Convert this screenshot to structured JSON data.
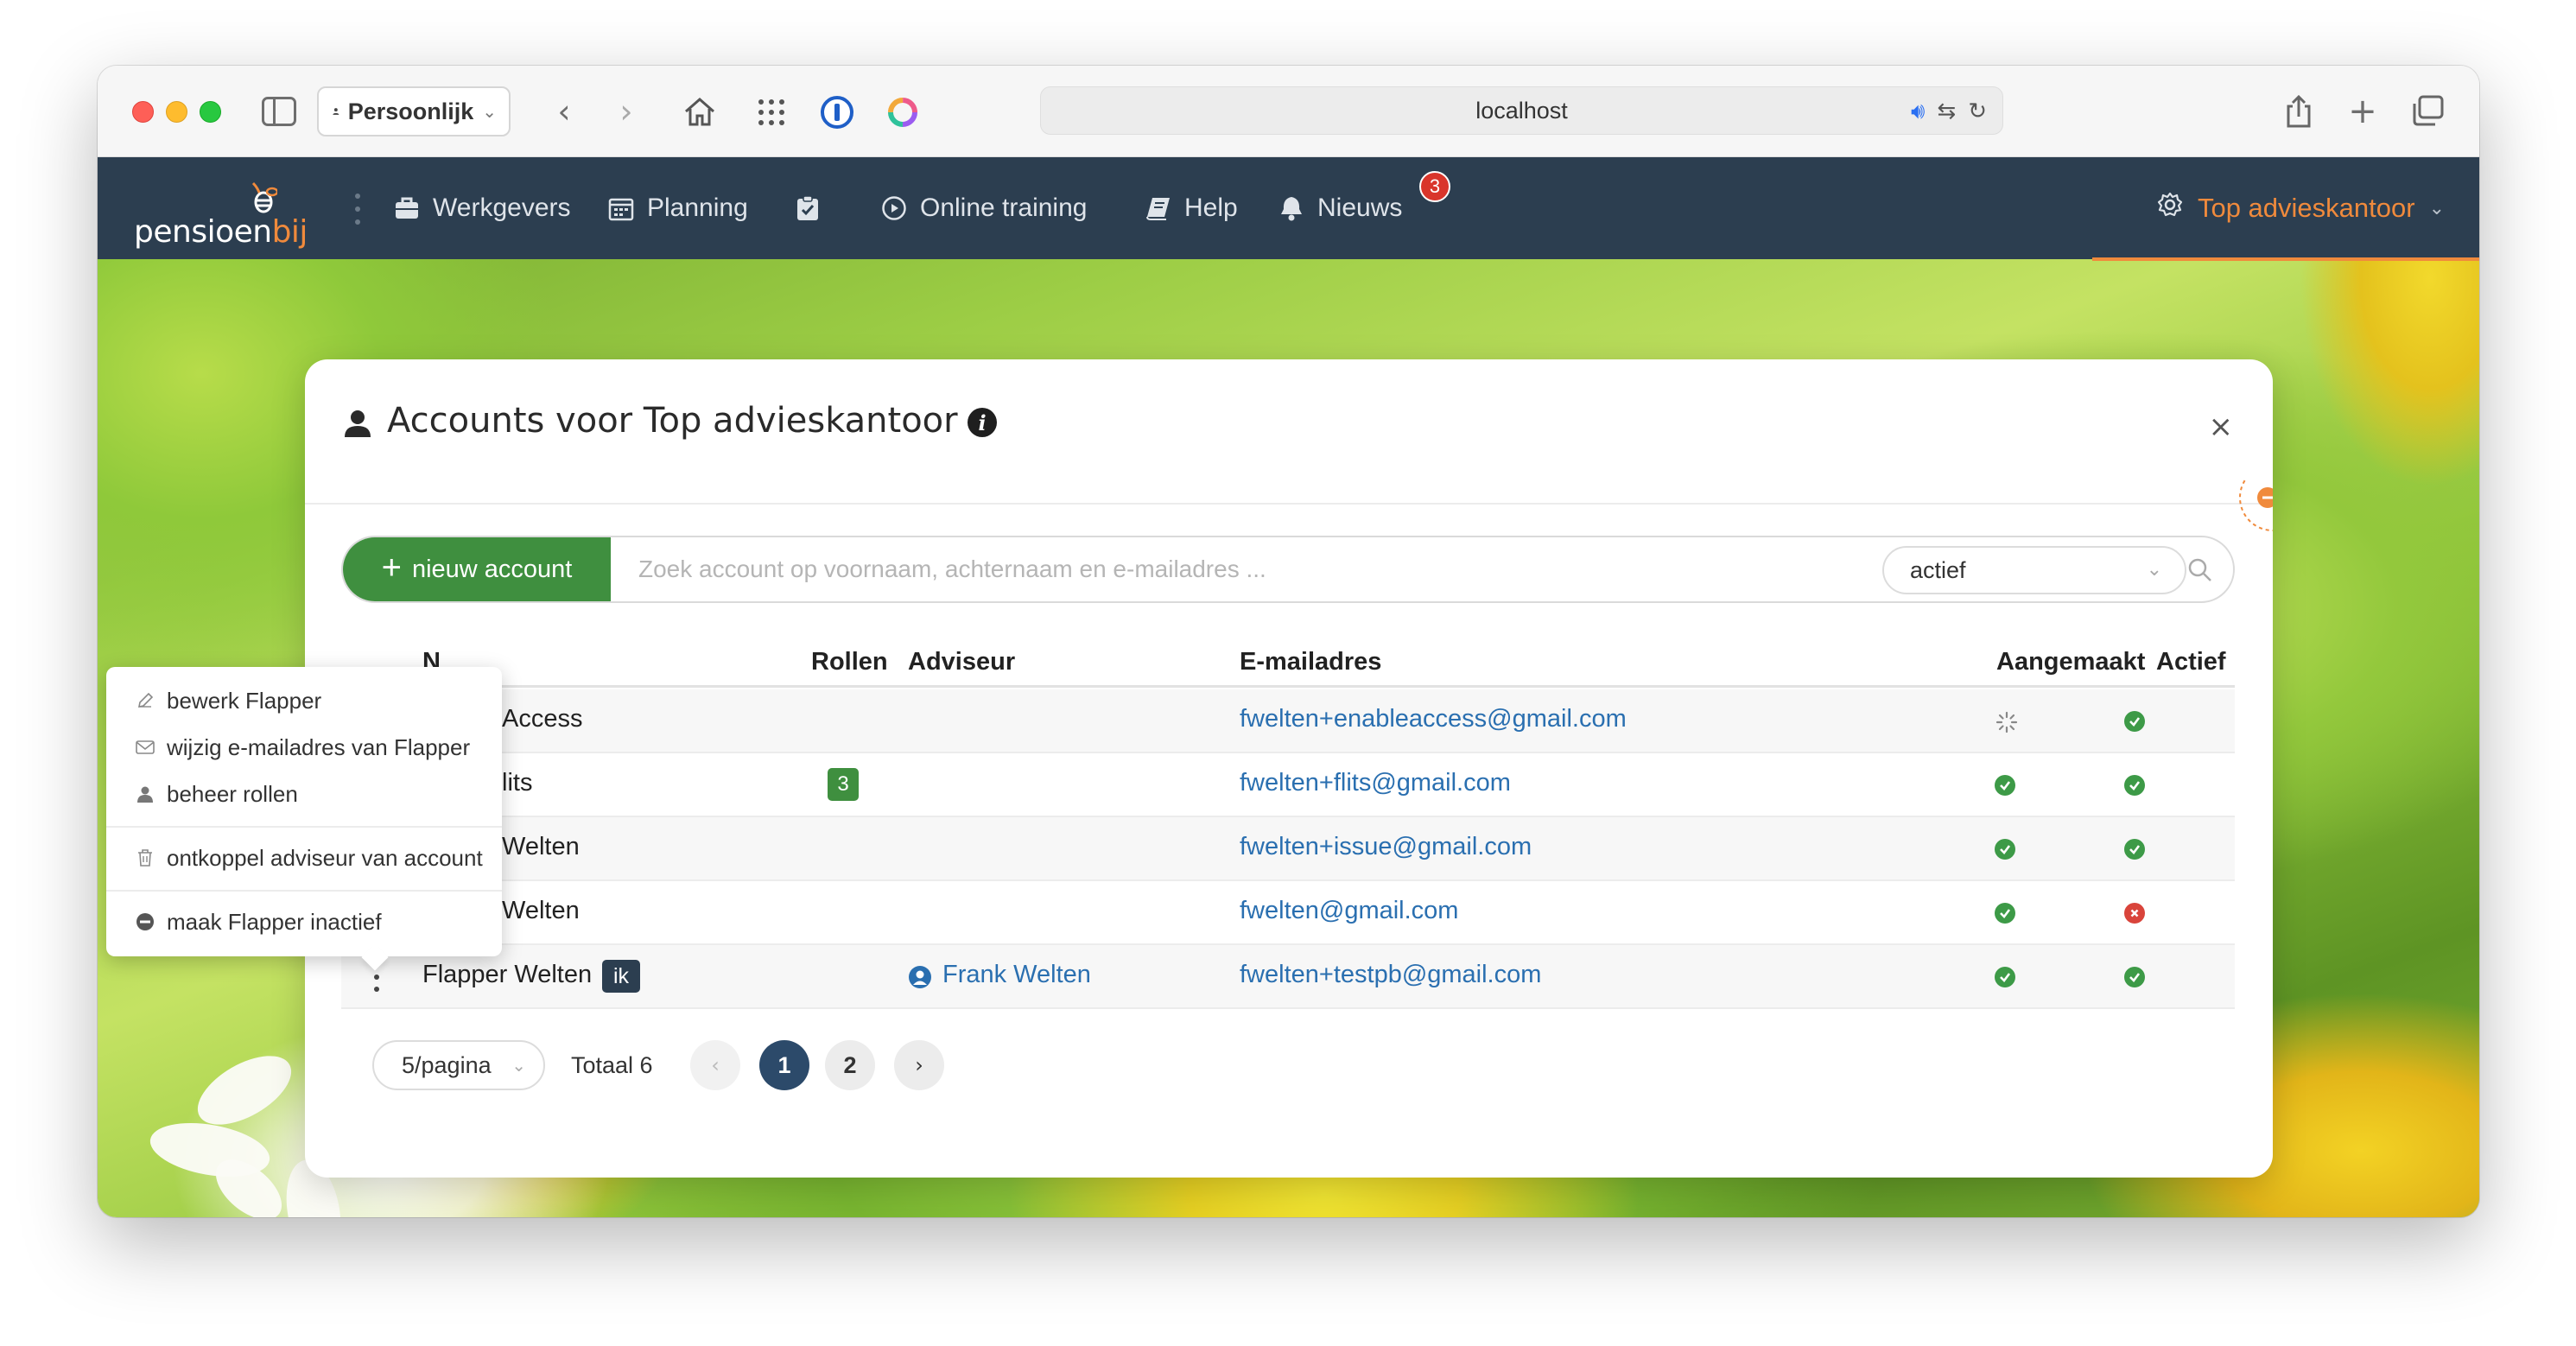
{
  "browser": {
    "profile": "Persoonlijk",
    "url": "localhost"
  },
  "nav": {
    "logo_main": "pensioen",
    "logo_accent": "bij",
    "items": [
      {
        "label": "Werkgevers",
        "icon": "briefcase-icon"
      },
      {
        "label": "Planning",
        "icon": "calendar-icon"
      },
      {
        "label": "",
        "icon": "clipboard-check-icon"
      },
      {
        "label": "Online training",
        "icon": "play-circle-icon"
      },
      {
        "label": "Help",
        "icon": "book-icon"
      },
      {
        "label": "Nieuws",
        "icon": "bell-icon",
        "badge": "3"
      }
    ],
    "organization": "Top advieskantoor",
    "accent_color": "#f08a3c",
    "bar_color": "#2c3e50"
  },
  "modal": {
    "title": "Accounts voor Top advieskantoor",
    "new_account_label": "nieuw account",
    "search_placeholder": "Zoek account op voornaam, achternaam en e-mailadres ...",
    "status_filter": "actief",
    "columns": {
      "name": "N",
      "roles": "Rollen",
      "advisor": "Adviseur",
      "email": "E-mailadres",
      "created": "Aangemaakt",
      "active": "Actief"
    },
    "rows": [
      {
        "name": "Access",
        "roles": "",
        "advisor": "",
        "email": "fwelten+enableaccess@gmail.com",
        "created": "pending",
        "active": "yes"
      },
      {
        "name": "lits",
        "roles": "3",
        "advisor": "",
        "email": "fwelten+flits@gmail.com",
        "created": "yes",
        "active": "yes"
      },
      {
        "name": "Welten",
        "roles": "",
        "advisor": "",
        "email": "fwelten+issue@gmail.com",
        "created": "yes",
        "active": "yes"
      },
      {
        "name": "Welten",
        "roles": "",
        "advisor": "",
        "email": "fwelten@gmail.com",
        "created": "yes",
        "active": "no"
      },
      {
        "name": "Flapper Welten",
        "self_badge": "ik",
        "roles": "",
        "advisor": "Frank Welten",
        "email": "fwelten+testpb@gmail.com",
        "created": "yes",
        "active": "yes"
      }
    ],
    "pagination": {
      "per_page": "5/pagina",
      "total": "Totaal 6",
      "pages": [
        "1",
        "2"
      ],
      "current": "1"
    }
  },
  "context_menu": {
    "items": [
      {
        "label": "bewerk Flapper",
        "icon": "pencil-icon"
      },
      {
        "label": "wijzig e-mailadres van Flapper",
        "icon": "envelope-icon"
      },
      {
        "label": "beheer rollen",
        "icon": "user-icon"
      },
      {
        "label": "ontkoppel adviseur van account",
        "icon": "trash-icon"
      },
      {
        "label": "maak Flapper inactief",
        "icon": "minus-circle-icon"
      }
    ]
  },
  "colors": {
    "success": "#3d9a47",
    "danger": "#d9443b",
    "link": "#2a6fb0",
    "primary_button": "#3f8f3f"
  }
}
